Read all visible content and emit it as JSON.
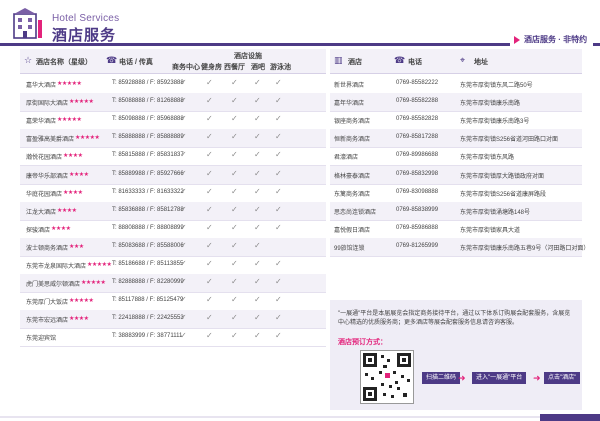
{
  "header": {
    "brand_en": "Hotel Services",
    "brand_cn": "酒店服务",
    "badge": "酒店服务 · 非特约",
    "accent": "#4d3a86",
    "highlight": "#e3237b"
  },
  "left_table": {
    "headers": {
      "name": "酒店名称（星级）",
      "phone": "电话 / 传真",
      "facilities": "酒店设施",
      "business": "商务中心",
      "gym": "健身房",
      "western": "西餐厅",
      "bar": "酒吧",
      "pool": "游泳池"
    },
    "rows": [
      {
        "name": "嘉华大酒店",
        "stars": "★★★★★",
        "phone": "T: 85928888 / F: 85923888",
        "checks": [
          1,
          1,
          1,
          1,
          1
        ]
      },
      {
        "name": "厚街国际大酒店",
        "stars": "★★★★★",
        "phone": "T: 85088888 / F: 81268888",
        "checks": [
          1,
          1,
          1,
          1,
          1
        ]
      },
      {
        "name": "嘉荣华酒店",
        "stars": "★★★★★",
        "phone": "T: 85098888 / F: 85968888",
        "checks": [
          1,
          1,
          1,
          1,
          1
        ]
      },
      {
        "name": "富盈雅高美爵酒店",
        "stars": "★★★★★",
        "phone": "T: 85888888 / F: 85888889",
        "checks": [
          1,
          1,
          1,
          1,
          1
        ]
      },
      {
        "name": "瀚悦花园酒店",
        "stars": "★★★★",
        "phone": "T: 85815888 / F: 85831837",
        "checks": [
          1,
          1,
          1,
          1,
          1
        ]
      },
      {
        "name": "康帝华乐部酒店",
        "stars": "★★★★",
        "phone": "T: 85889988 / F: 85927666",
        "checks": [
          1,
          1,
          1,
          1,
          1
        ]
      },
      {
        "name": "华庭花园酒店",
        "stars": "★★★★",
        "phone": "T: 81633333 / F: 81633322",
        "checks": [
          1,
          1,
          1,
          1,
          1
        ]
      },
      {
        "name": "江龙大酒店",
        "stars": "★★★★",
        "phone": "T: 85836888 / F: 85812788",
        "checks": [
          1,
          1,
          1,
          1,
          1
        ]
      },
      {
        "name": "探骏酒店",
        "stars": "★★★★",
        "phone": "T: 88808888 / F: 88808899",
        "checks": [
          1,
          1,
          1,
          1,
          1
        ]
      },
      {
        "name": "波士顿商务酒店",
        "stars": "★★★",
        "phone": "T: 85083688 / F: 85588006",
        "checks": [
          1,
          1,
          1,
          1,
          0
        ]
      },
      {
        "name": "东莞市龙泉国际大酒店",
        "stars": "★★★★★",
        "phone": "T: 85186688 / F: 85113855",
        "checks": [
          1,
          1,
          1,
          1,
          1
        ]
      },
      {
        "name": "虎门美思威尔顿酒店",
        "stars": "★★★★★",
        "phone": "T: 82888888 / F: 82280999",
        "checks": [
          1,
          1,
          1,
          1,
          1
        ]
      },
      {
        "name": "东莞厚门大饭店",
        "stars": "★★★★★",
        "phone": "T: 85117888 / F: 85125479",
        "checks": [
          1,
          1,
          1,
          1,
          1
        ]
      },
      {
        "name": "东莞市宏远酒店",
        "stars": "★★★★",
        "phone": "T: 22418888 / F: 22425553",
        "checks": [
          1,
          1,
          1,
          1,
          1
        ]
      },
      {
        "name": "东莞迎宾馆",
        "stars": "",
        "phone": "T: 38883999 / F: 38771111",
        "checks": [
          1,
          1,
          1,
          1,
          1
        ]
      }
    ]
  },
  "right_table": {
    "headers": {
      "hotel": "酒店",
      "phone": "电话",
      "address": "地址"
    },
    "rows": [
      {
        "hotel": "新世界酒店",
        "phone": "0769-85582222",
        "address": "东莞市厚街镇东风二路50号"
      },
      {
        "hotel": "嘉年华酒店",
        "phone": "0769-85582288",
        "address": "东莞市厚街镇康乐南路"
      },
      {
        "hotel": "银座商务酒店",
        "phone": "0769-85582828",
        "address": "东莞市厚街镇康乐南路3号"
      },
      {
        "hotel": "恒新商务酒店",
        "phone": "0769-85817288",
        "address": "东莞市厚街镇S256省道河田路口对面"
      },
      {
        "hotel": "君濠酒店",
        "phone": "0769-89986688",
        "address": "东莞市厚街镇东风路"
      },
      {
        "hotel": "格林豪泰酒店",
        "phone": "0769-85832998",
        "address": "东莞市厚街镇厚大路镇政府对面"
      },
      {
        "hotel": "东篱商务酒店",
        "phone": "0769-83098888",
        "address": "东莞市厚街镇S256省道康屏路段"
      },
      {
        "hotel": "思恋尚连锁酒店",
        "phone": "0769-85838999",
        "address": "东莞市厚街镇涌塘路148号"
      },
      {
        "hotel": "嘉悦假日酒店",
        "phone": "0769-85986888",
        "address": "东莞市厚街镇家具大道"
      },
      {
        "hotel": "99旅馆连锁",
        "phone": "0769-81265999",
        "address": "东莞市厚街镇康乐南路五巷9号（河田路口对面）"
      }
    ]
  },
  "promo": {
    "text": "\"一展通\"平台是本届展览会指定商务接待平台，通过以下体系订购展会配套服务，含展览中心精选的优质服务商；更多酒店等展会配套服务信息请咨询客服。",
    "label": "酒店预订方式：",
    "step1": "扫描二维码",
    "step2": "进入\"一展通\"平台",
    "step3": "点击\"酒店\""
  }
}
